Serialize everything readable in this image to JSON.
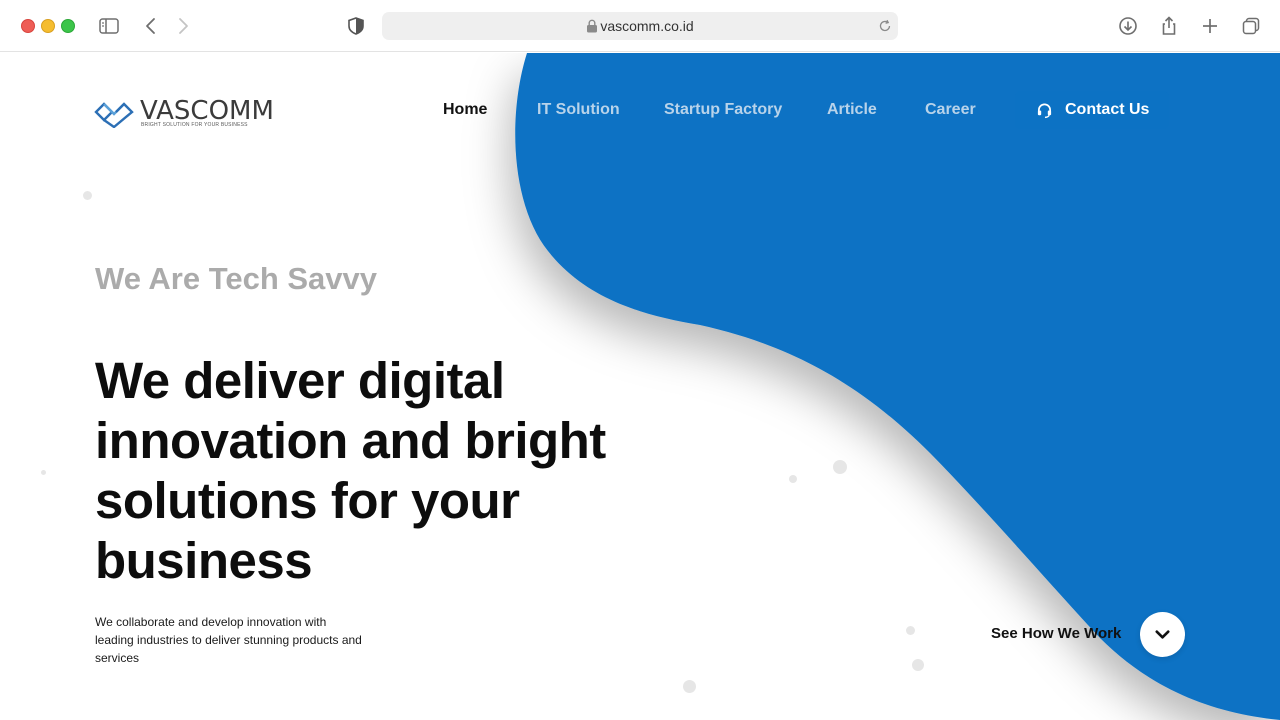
{
  "browser": {
    "url": "vascomm.co.id",
    "icons": [
      "sidebar-icon",
      "back-icon",
      "forward-icon",
      "privacy-shield-icon",
      "lock-icon",
      "reload-icon",
      "download-icon",
      "share-icon",
      "new-tab-icon",
      "tab-overview-icon"
    ]
  },
  "header": {
    "logo_text": "VASCOMM",
    "logo_tagline": "BRIGHT SOLUTION FOR YOUR BUSINESS",
    "nav": [
      {
        "label": "Home",
        "active": true
      },
      {
        "label": "IT Solution",
        "active": false
      },
      {
        "label": "Startup Factory",
        "active": false
      },
      {
        "label": "Article",
        "active": false
      },
      {
        "label": "Career",
        "active": false
      }
    ],
    "contact_label": "Contact Us",
    "contact_icon": "headset-icon"
  },
  "hero": {
    "tagline": "We Are Tech Savvy",
    "headline": "We deliver digital innovation and bright solutions for your business",
    "subtext": "We collaborate and develop innovation with leading industries to deliver stunning products and services",
    "see_how": "See How We Work",
    "scroll_icon": "chevron-down-icon"
  },
  "colors": {
    "brand_blue": "#0c72c4",
    "nav_inactive": "#b8d3ea",
    "tagline_gray": "#ababab"
  }
}
